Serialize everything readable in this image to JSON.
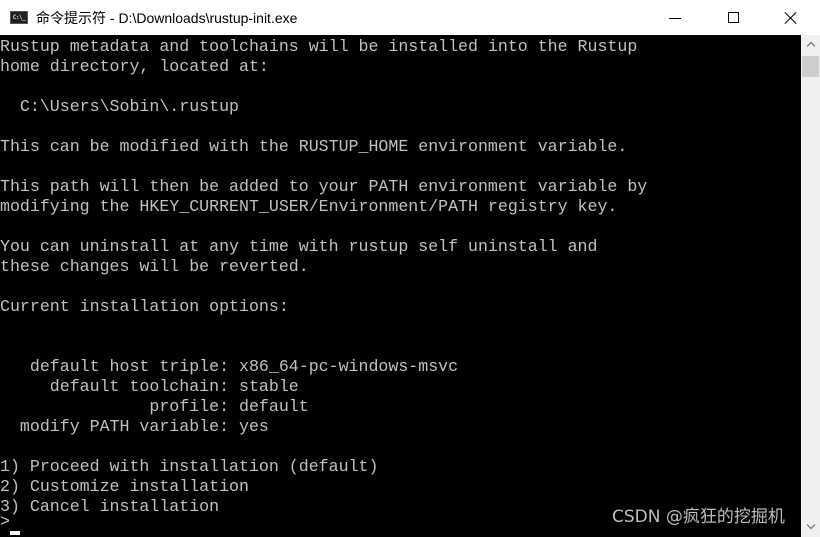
{
  "window": {
    "title": "命令提示符 - D:\\Downloads\\rustup-init.exe",
    "icon": "cmd-icon",
    "icon_text": "C:\\_",
    "controls": {
      "minimize": "minimize-icon",
      "maximize": "maximize-icon",
      "close": "close-icon"
    }
  },
  "console": {
    "background": "#000000",
    "foreground": "#c0c0c0",
    "lines": [
      "Rustup metadata and toolchains will be installed into the Rustup",
      "home directory, located at:",
      "",
      "  C:\\Users\\Sobin\\.rustup",
      "",
      "This can be modified with the RUSTUP_HOME environment variable.",
      "",
      "This path will then be added to your PATH environment variable by",
      "modifying the HKEY_CURRENT_USER/Environment/PATH registry key.",
      "",
      "You can uninstall at any time with rustup self uninstall and",
      "these changes will be reverted.",
      "",
      "Current installation options:",
      "",
      "",
      "   default host triple: x86_64-pc-windows-msvc",
      "     default toolchain: stable",
      "               profile: default",
      "  modify PATH variable: yes",
      "",
      "1) Proceed with installation (default)",
      "2) Customize installation",
      "3) Cancel installation",
      ">"
    ]
  },
  "scrollbar": {
    "up_icon": "chevron-up-icon",
    "down_icon": "chevron-down-icon"
  },
  "watermark": "CSDN @疯狂的挖掘机"
}
